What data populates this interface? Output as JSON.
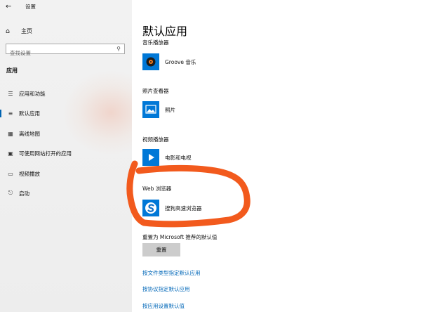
{
  "window": {
    "title": "设置",
    "back_icon": "back-arrow-icon"
  },
  "sidebar": {
    "home_label": "主页",
    "search_placeholder": "查找设置",
    "section_title": "应用",
    "items": [
      {
        "label": "应用和功能",
        "icon": "apps-list-icon",
        "selected": false
      },
      {
        "label": "默认应用",
        "icon": "default-apps-icon",
        "selected": true
      },
      {
        "label": "离线地图",
        "icon": "map-icon",
        "selected": false
      },
      {
        "label": "可使用网站打开的应用",
        "icon": "web-app-icon",
        "selected": false
      },
      {
        "label": "视频播放",
        "icon": "video-icon",
        "selected": false
      },
      {
        "label": "启动",
        "icon": "startup-icon",
        "selected": false
      }
    ]
  },
  "main": {
    "title": "默认应用",
    "categories": [
      {
        "label": "音乐播放器",
        "app": "Groove 音乐",
        "icon": "groove-music-icon"
      },
      {
        "label": "照片查看器",
        "app": "照片",
        "icon": "photos-icon"
      },
      {
        "label": "视频播放器",
        "app": "电影和电视",
        "icon": "movies-tv-icon"
      },
      {
        "label": "Web 浏览器",
        "app": "搜狗高速浏览器",
        "icon": "sogou-browser-icon"
      }
    ],
    "reset_label": "重置为 Microsoft 推荐的默认值",
    "reset_button": "重置",
    "links": [
      "按文件类型指定默认应用",
      "按协议指定默认应用",
      "按应用设置默认值"
    ]
  },
  "colors": {
    "accent": "#0063b1",
    "link": "#0067b8",
    "annotation": "#f25a1d",
    "tile": "#0078d7"
  }
}
